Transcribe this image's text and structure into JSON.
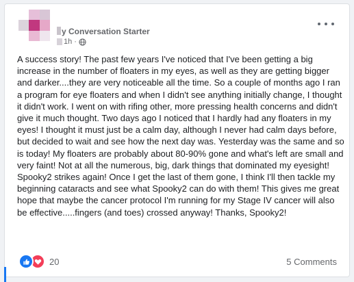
{
  "post": {
    "author_suffix": "y Conversation Starter",
    "time": "1h",
    "privacy_icon": "globe-icon",
    "text": "A success story! The past few years I've noticed that I've been getting a big increase in the number of floaters in my eyes, as well as they are getting bigger and darker....they are very noticeable all the time. So a couple of months ago I ran a program for eye floaters and when I didn't see anything initially change, I thought it didn't work. I went on with rifing other, more pressing health concerns and didn't give it much thought.  Two days ago I noticed that I hardly had any floaters in my eyes!  I thought it must just be a calm day, although I never had calm days before, but decided to wait and see how the next day was. Yesterday was the same and so is today!  My floaters are probably about 80-90% gone and what's left are small and very faint!  Not at all the numerous, big, dark things that dominated my eyesight!  Spooky2 strikes again!  Once I get the last of them gone, I think I'll then tackle my beginning cataracts and see what Spooky2 can do with them! This gives me great hope that maybe the cancer protocol I'm running for my Stage IV cancer  will also be effective.....fingers (and toes) crossed anyway!  Thanks, Spooky2!"
  },
  "footer": {
    "reaction_count": "20",
    "comments_label": "5 Comments"
  },
  "colors": {
    "like": "#1877f2",
    "love": "#f33e58",
    "secondary_text": "#65676b"
  }
}
